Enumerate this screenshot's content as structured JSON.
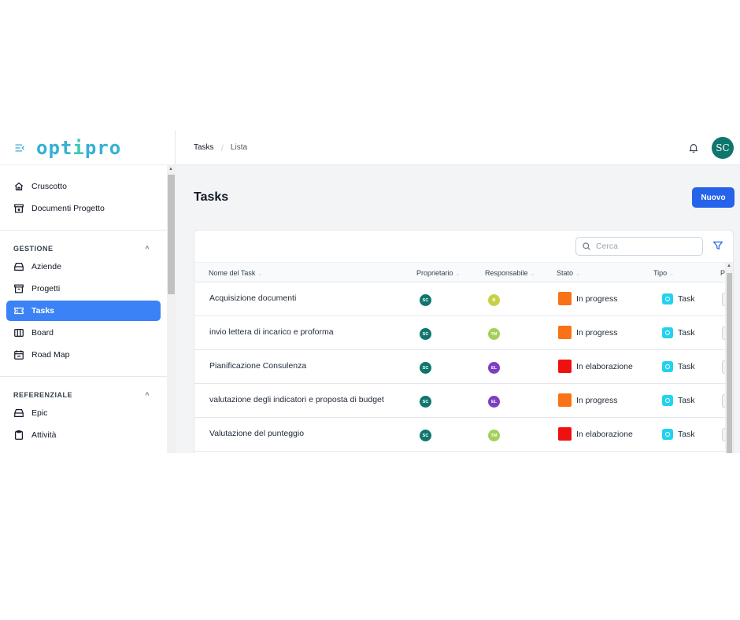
{
  "brand": {
    "logo_text": "optipro",
    "accent": "#36b0d5"
  },
  "breadcrumb": {
    "root": "Tasks",
    "current": "Lista"
  },
  "user": {
    "initials": "SC"
  },
  "sidebar": {
    "main_items": [
      {
        "label": "Cruscotto",
        "icon": "home-icon"
      },
      {
        "label": "Documenti Progetto",
        "icon": "archive-icon"
      }
    ],
    "gestione": {
      "title": "GESTIONE",
      "items": [
        {
          "label": "Aziende",
          "icon": "drawer-icon"
        },
        {
          "label": "Progetti",
          "icon": "archive-icon"
        },
        {
          "label": "Tasks",
          "icon": "ticket-icon",
          "active": true
        },
        {
          "label": "Board",
          "icon": "columns-icon"
        },
        {
          "label": "Road Map",
          "icon": "calendar-icon"
        }
      ]
    },
    "referenziale": {
      "title": "REFERENZIALE",
      "items": [
        {
          "label": "Epic",
          "icon": "drawer-icon"
        },
        {
          "label": "Attività",
          "icon": "clipboard-icon"
        }
      ]
    }
  },
  "page": {
    "title": "Tasks",
    "new_button": "Nuovo"
  },
  "search": {
    "placeholder": "Cerca"
  },
  "table": {
    "columns": [
      "Nome del Task",
      "Proprietario",
      "Responsabile",
      "Stato",
      "Tipo",
      "P"
    ],
    "rows": [
      {
        "name": "Acquisizione documenti",
        "owner": "SC",
        "owner_color": "#0f766e",
        "assignee": "B",
        "assignee_color": "#c6d243",
        "status": "In progress",
        "status_color": "#f97316",
        "type": "Task"
      },
      {
        "name": "invio lettera di incarico e proforma",
        "owner": "SC",
        "owner_color": "#0f766e",
        "assignee": "TM",
        "assignee_color": "#a3d05a",
        "status": "In progress",
        "status_color": "#f97316",
        "type": "Task"
      },
      {
        "name": "Pianificazione Consulenza",
        "owner": "SC",
        "owner_color": "#0f766e",
        "assignee": "EL",
        "assignee_color": "#7e3fbf",
        "status": "In elaborazione",
        "status_color": "#ef1010",
        "type": "Task"
      },
      {
        "name": "valutazione degli indicatori e proposta di budget",
        "owner": "SC",
        "owner_color": "#0f766e",
        "assignee": "EL",
        "assignee_color": "#7e3fbf",
        "status": "In progress",
        "status_color": "#f97316",
        "type": "Task"
      },
      {
        "name": "Valutazione del punteggio",
        "owner": "SC",
        "owner_color": "#0f766e",
        "assignee": "TM",
        "assignee_color": "#a3d05a",
        "status": "In elaborazione",
        "status_color": "#ef1010",
        "type": "Task"
      }
    ]
  }
}
